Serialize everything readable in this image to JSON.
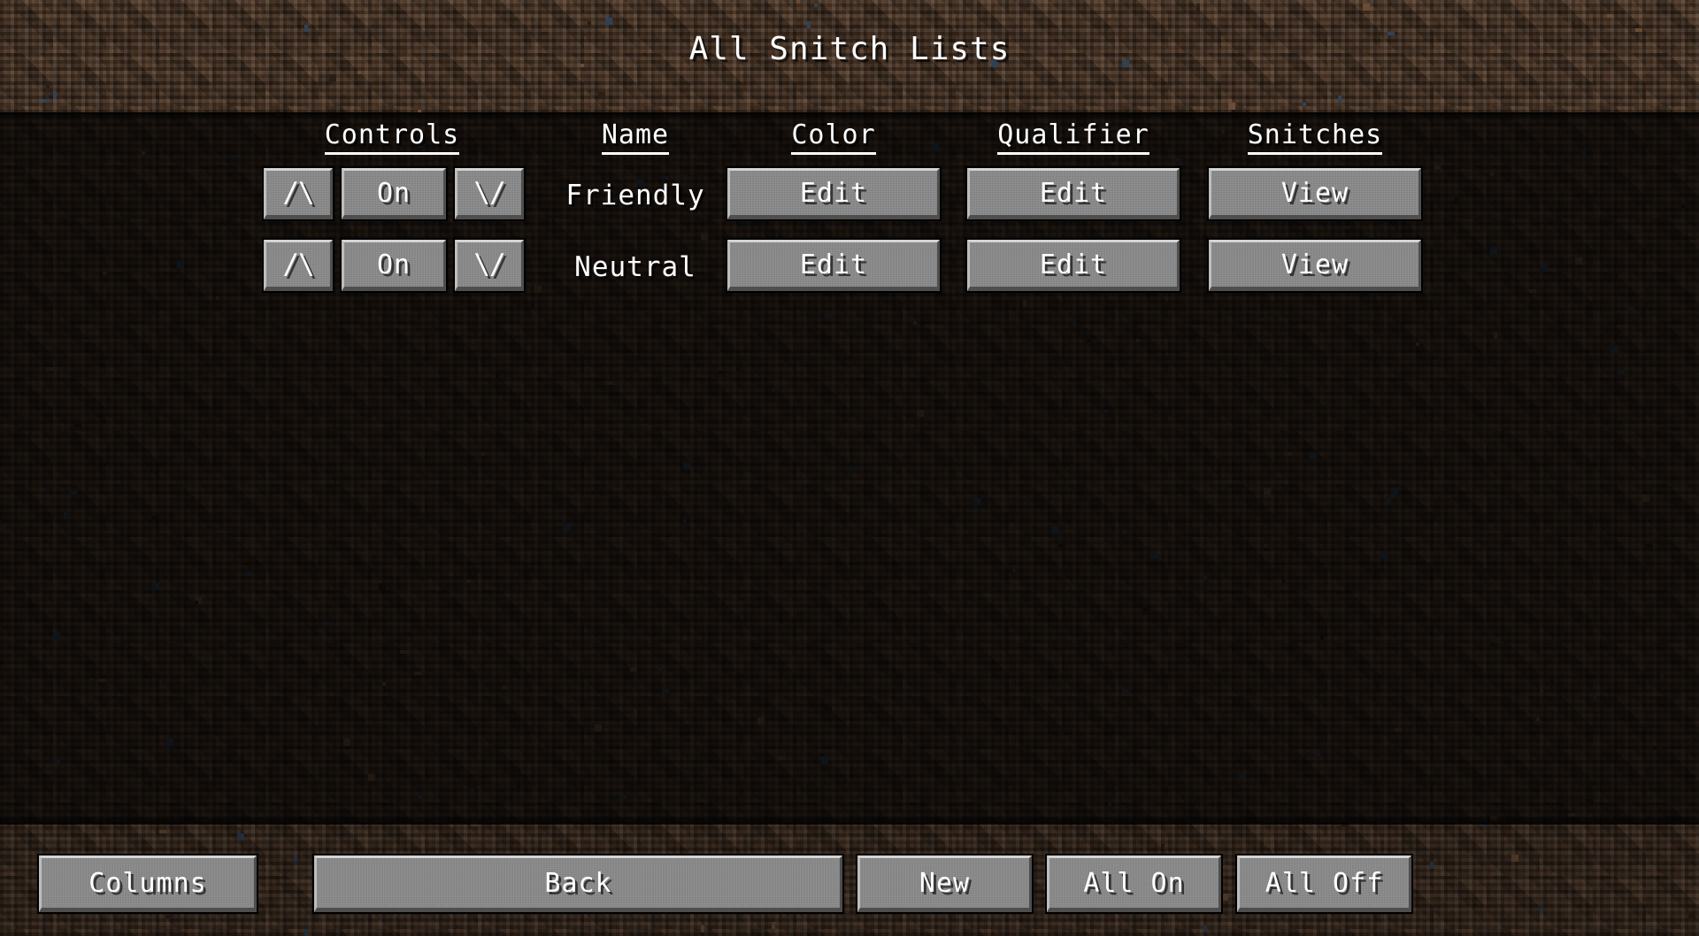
{
  "window": {
    "title": "All Snitch Lists",
    "background": "minecraft-dirt",
    "bg_color": "#4a3526",
    "button_face_color": "#8b8b8b",
    "text_color": "#ffffff"
  },
  "table": {
    "headers": [
      {
        "key": "controls",
        "label": "Controls"
      },
      {
        "key": "name",
        "label": "Name"
      },
      {
        "key": "color",
        "label": "Color"
      },
      {
        "key": "qualifier",
        "label": "Qualifier"
      },
      {
        "key": "snitches",
        "label": "Snitches"
      }
    ],
    "rows": [
      {
        "move_up_label": "/\\",
        "toggle_label": "On",
        "move_down_label": "\\/",
        "name": "Friendly",
        "color_label": "Edit",
        "qualifier_label": "Edit",
        "snitches_label": "View"
      },
      {
        "move_up_label": "/\\",
        "toggle_label": "On",
        "move_down_label": "\\/",
        "name": "Neutral",
        "color_label": "Edit",
        "qualifier_label": "Edit",
        "snitches_label": "View"
      }
    ]
  },
  "footer": {
    "columns_label": "Columns",
    "back_label": "Back",
    "new_label": "New",
    "all_on_label": "All On",
    "all_off_label": "All Off"
  }
}
